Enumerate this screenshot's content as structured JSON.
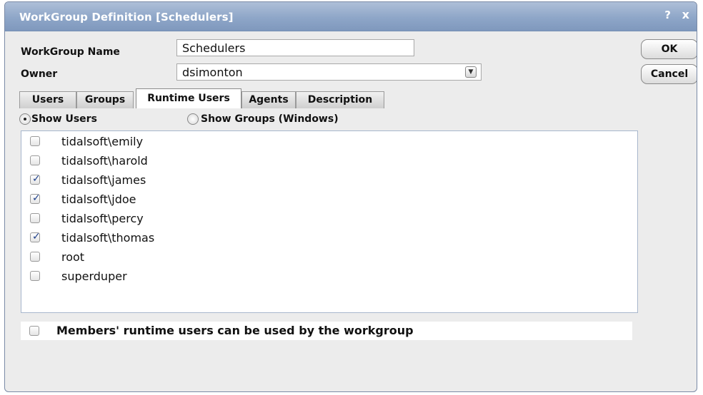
{
  "window": {
    "title": "WorkGroup Definition [Schedulers]",
    "help_label": "?",
    "close_label": "x"
  },
  "form": {
    "name_label": "WorkGroup Name",
    "name_value": "Schedulers",
    "owner_label": "Owner",
    "owner_value": "dsimonton"
  },
  "buttons": {
    "ok": "OK",
    "cancel": "Cancel"
  },
  "tabs": [
    {
      "label": "Users",
      "active": false
    },
    {
      "label": "Groups",
      "active": false
    },
    {
      "label": "Runtime Users",
      "active": true
    },
    {
      "label": "Agents",
      "active": false
    },
    {
      "label": "Description",
      "active": false
    }
  ],
  "filter": {
    "show_users": "Show Users",
    "show_groups": "Show Groups (Windows)",
    "selected": "show_users"
  },
  "users": [
    {
      "label": "tidalsoft\\emily",
      "checked": false
    },
    {
      "label": "tidalsoft\\harold",
      "checked": false
    },
    {
      "label": "tidalsoft\\james",
      "checked": true
    },
    {
      "label": "tidalsoft\\jdoe",
      "checked": true
    },
    {
      "label": "tidalsoft\\percy",
      "checked": false
    },
    {
      "label": "tidalsoft\\thomas",
      "checked": true
    },
    {
      "label": "root",
      "checked": false
    },
    {
      "label": "superduper",
      "checked": false
    }
  ],
  "members_option": {
    "label": "Members' runtime users can be used by the workgroup",
    "checked": false
  },
  "colors": {
    "titlebar": "#8ea6c8",
    "check": "#1d3f8a",
    "dialog_bg": "#ececec"
  }
}
